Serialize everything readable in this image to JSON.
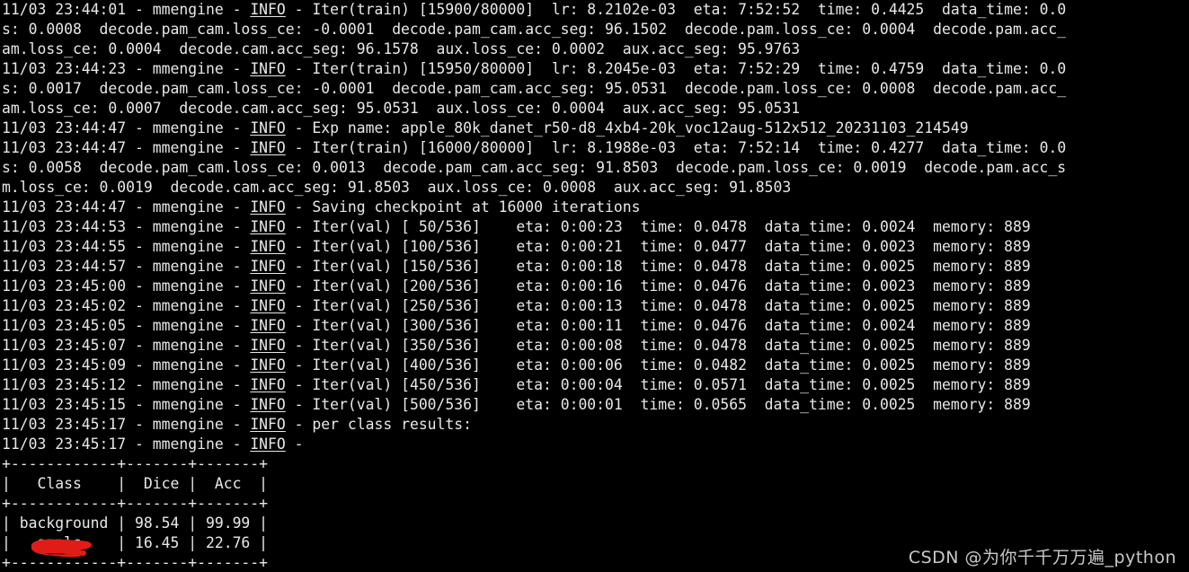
{
  "terminal": {
    "background_color": "#000000",
    "foreground_color": "#e8e8e8",
    "redaction_color": "#e01c18",
    "watermark": "CSDN @为你千千万万遍_python"
  },
  "log": {
    "lines": [
      {
        "id": "l1",
        "pre": "11/03 23:44:01 - mmengine - ",
        "level": "INFO",
        "post": " - Iter(train) [15900/80000]  lr: 8.2102e-03  eta: 7:52:52  time: 0.4425  data_time: 0.0"
      },
      {
        "id": "l2",
        "pre": "s: 0.0008  decode.pam_cam.loss_ce: -0.0001  decode.pam_cam.acc_seg: 96.1502  decode.pam.loss_ce: 0.0004  decode.pam.acc_",
        "level": "",
        "post": ""
      },
      {
        "id": "l3",
        "pre": "am.loss_ce: 0.0004  decode.cam.acc_seg: 96.1578  aux.loss_ce: 0.0002  aux.acc_seg: 95.9763",
        "level": "",
        "post": ""
      },
      {
        "id": "l4",
        "pre": "11/03 23:44:23 - mmengine - ",
        "level": "INFO",
        "post": " - Iter(train) [15950/80000]  lr: 8.2045e-03  eta: 7:52:29  time: 0.4759  data_time: 0.0"
      },
      {
        "id": "l5",
        "pre": "s: 0.0017  decode.pam_cam.loss_ce: -0.0001  decode.pam_cam.acc_seg: 95.0531  decode.pam.loss_ce: 0.0008  decode.pam.acc_",
        "level": "",
        "post": ""
      },
      {
        "id": "l6",
        "pre": "am.loss_ce: 0.0007  decode.cam.acc_seg: 95.0531  aux.loss_ce: 0.0004  aux.acc_seg: 95.0531",
        "level": "",
        "post": ""
      },
      {
        "id": "l7",
        "pre": "11/03 23:44:47 - mmengine - ",
        "level": "INFO",
        "post": " - Exp name: apple_80k_danet_r50-d8_4xb4-20k_voc12aug-512x512_20231103_214549"
      },
      {
        "id": "l8",
        "pre": "11/03 23:44:47 - mmengine - ",
        "level": "INFO",
        "post": " - Iter(train) [16000/80000]  lr: 8.1988e-03  eta: 7:52:14  time: 0.4277  data_time: 0.0"
      },
      {
        "id": "l9",
        "pre": "s: 0.0058  decode.pam_cam.loss_ce: 0.0013  decode.pam_cam.acc_seg: 91.8503  decode.pam.loss_ce: 0.0019  decode.pam.acc_s",
        "level": "",
        "post": ""
      },
      {
        "id": "l10",
        "pre": "m.loss_ce: 0.0019  decode.cam.acc_seg: 91.8503  aux.loss_ce: 0.0008  aux.acc_seg: 91.8503",
        "level": "",
        "post": ""
      },
      {
        "id": "l11",
        "pre": "11/03 23:44:47 - mmengine - ",
        "level": "INFO",
        "post": " - Saving checkpoint at 16000 iterations"
      },
      {
        "id": "l12",
        "pre": "11/03 23:44:53 - mmengine - ",
        "level": "INFO",
        "post": " - Iter(val) [ 50/536]    eta: 0:00:23  time: 0.0478  data_time: 0.0024  memory: 889"
      },
      {
        "id": "l13",
        "pre": "11/03 23:44:55 - mmengine - ",
        "level": "INFO",
        "post": " - Iter(val) [100/536]    eta: 0:00:21  time: 0.0477  data_time: 0.0023  memory: 889"
      },
      {
        "id": "l14",
        "pre": "11/03 23:44:57 - mmengine - ",
        "level": "INFO",
        "post": " - Iter(val) [150/536]    eta: 0:00:18  time: 0.0478  data_time: 0.0025  memory: 889"
      },
      {
        "id": "l15",
        "pre": "11/03 23:45:00 - mmengine - ",
        "level": "INFO",
        "post": " - Iter(val) [200/536]    eta: 0:00:16  time: 0.0476  data_time: 0.0023  memory: 889"
      },
      {
        "id": "l16",
        "pre": "11/03 23:45:02 - mmengine - ",
        "level": "INFO",
        "post": " - Iter(val) [250/536]    eta: 0:00:13  time: 0.0478  data_time: 0.0025  memory: 889"
      },
      {
        "id": "l17",
        "pre": "11/03 23:45:05 - mmengine - ",
        "level": "INFO",
        "post": " - Iter(val) [300/536]    eta: 0:00:11  time: 0.0476  data_time: 0.0024  memory: 889"
      },
      {
        "id": "l18",
        "pre": "11/03 23:45:07 - mmengine - ",
        "level": "INFO",
        "post": " - Iter(val) [350/536]    eta: 0:00:08  time: 0.0478  data_time: 0.0025  memory: 889"
      },
      {
        "id": "l19",
        "pre": "11/03 23:45:09 - mmengine - ",
        "level": "INFO",
        "post": " - Iter(val) [400/536]    eta: 0:00:06  time: 0.0482  data_time: 0.0025  memory: 889"
      },
      {
        "id": "l20",
        "pre": "11/03 23:45:12 - mmengine - ",
        "level": "INFO",
        "post": " - Iter(val) [450/536]    eta: 0:00:04  time: 0.0571  data_time: 0.0025  memory: 889"
      },
      {
        "id": "l21",
        "pre": "11/03 23:45:15 - mmengine - ",
        "level": "INFO",
        "post": " - Iter(val) [500/536]    eta: 0:00:01  time: 0.0565  data_time: 0.0025  memory: 889"
      },
      {
        "id": "l22",
        "pre": "11/03 23:45:17 - mmengine - ",
        "level": "INFO",
        "post": " - per class results:"
      },
      {
        "id": "l23",
        "pre": "11/03 23:45:17 - mmengine - ",
        "level": "INFO",
        "post": " -"
      },
      {
        "id": "l24",
        "pre": "+------------+-------+-------+",
        "level": "",
        "post": ""
      },
      {
        "id": "l25",
        "pre": "|   Class    |  Dice |  Acc  |",
        "level": "",
        "post": ""
      },
      {
        "id": "l26",
        "pre": "+------------+-------+-------+",
        "level": "",
        "post": ""
      },
      {
        "id": "l27",
        "pre": "| background | 98.54 | 99.99 |",
        "level": "",
        "post": ""
      },
      {
        "id": "l28",
        "pre": "|   apple    | 16.45 | 22.76 |",
        "level": "",
        "post": ""
      },
      {
        "id": "l29",
        "pre": "+------------+-------+-------+",
        "level": "",
        "post": ""
      }
    ]
  },
  "per_class_results": {
    "headers": [
      "Class",
      "Dice",
      "Acc"
    ],
    "rows": [
      {
        "class": "background",
        "dice": "98.54",
        "acc": "99.99",
        "redacted": false
      },
      {
        "class": "",
        "dice": "16.45",
        "acc": "22.76",
        "redacted": true
      }
    ]
  }
}
